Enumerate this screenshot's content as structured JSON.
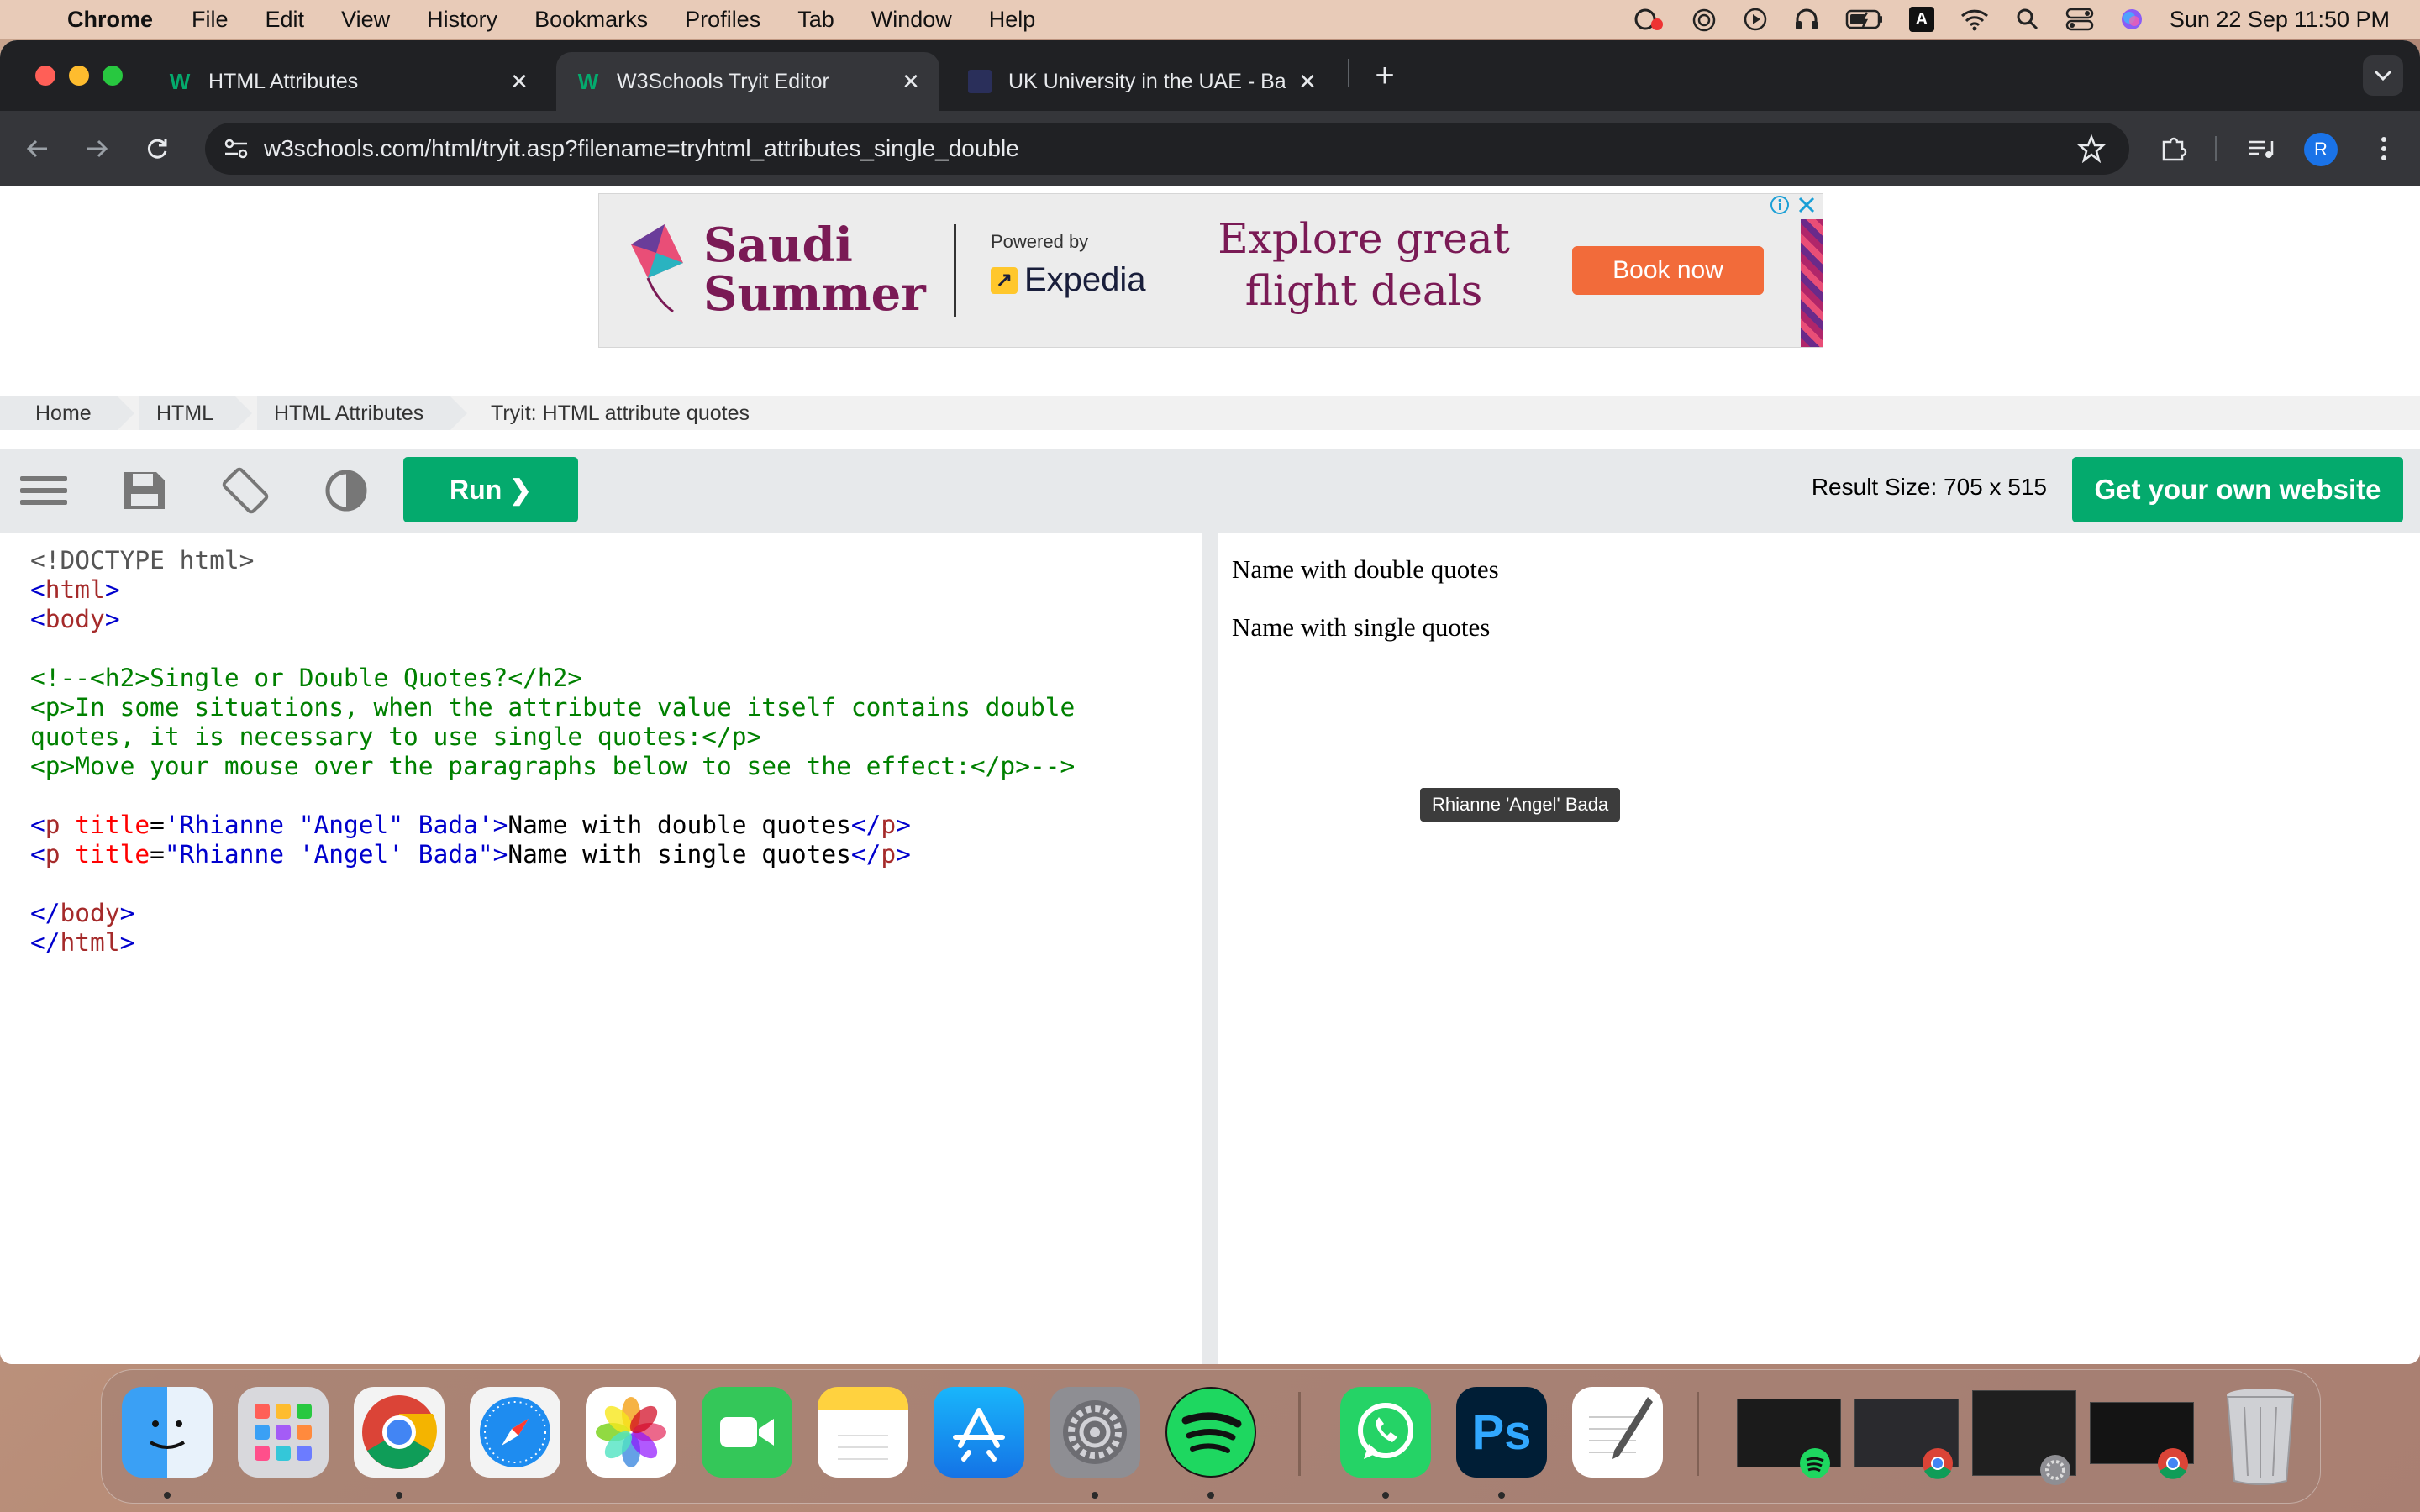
{
  "menubar": {
    "app": "Chrome",
    "items": [
      "File",
      "Edit",
      "View",
      "History",
      "Bookmarks",
      "Profiles",
      "Tab",
      "Window",
      "Help"
    ],
    "clock": "Sun 22 Sep  11:50 PM",
    "input_indicator": "A"
  },
  "browser": {
    "tabs": [
      {
        "title": "HTML Attributes",
        "favicon": "w3schools-icon",
        "active": false
      },
      {
        "title": "W3Schools Tryit Editor",
        "favicon": "w3schools-icon",
        "active": true
      },
      {
        "title": "UK University in the UAE - Ba",
        "favicon": "university-icon",
        "active": false
      }
    ],
    "new_tab_glyph": "+",
    "url": "w3schools.com/html/tryit.asp?filename=tryhtml_attributes_single_double",
    "profile_initial": "R"
  },
  "ad": {
    "brand_line1": "Saudi",
    "brand_line2": "Summer",
    "powered_by": "Powered by",
    "partner": "Expedia",
    "headline_line1": "Explore great",
    "headline_line2": "flight deals",
    "cta": "Book now",
    "colors": {
      "brand": "#7a1a55",
      "cta": "#f26b3a"
    }
  },
  "breadcrumb": {
    "items": [
      "Home",
      "HTML",
      "HTML Attributes"
    ],
    "current": "Tryit: HTML attribute quotes"
  },
  "editor": {
    "run_label": "Run ❯",
    "result_size": "Result Size: 705 x 515",
    "get_website_label": "Get your own website",
    "accent": "#04aa6d",
    "code": {
      "l1": "<!DOCTYPE html>",
      "l2_tag": "html",
      "l3_tag": "body",
      "c1": "<!--<h2>Single or Double Quotes?</h2>",
      "c2": "<p>In some situations, when the attribute value itself contains double",
      "c3": "quotes, it is necessary to use single quotes:</p>",
      "c4": "<p>Move your mouse over the paragraphs below to see the effect:</p>-->",
      "p_tag": "p",
      "p_attr": "title",
      "p1_value": "'Rhianne \"Angel\" Bada'",
      "p1_text": "Name with double quotes",
      "p2_value": "\"Rhianne 'Angel' Bada\"",
      "p2_text": "Name with single quotes",
      "close_body": "body",
      "close_html": "html"
    }
  },
  "result": {
    "p1": "Name with double quotes",
    "p2": "Name with single quotes",
    "tooltip": "Rhianne 'Angel' Bada"
  },
  "dock": {
    "apps": [
      "Finder",
      "Launchpad",
      "Chrome",
      "Safari",
      "Photos",
      "FaceTime",
      "Notes",
      "App Store",
      "System Settings",
      "Spotify",
      "WhatsApp",
      "Photoshop",
      "TextEdit"
    ],
    "photoshop_label": "Ps"
  }
}
